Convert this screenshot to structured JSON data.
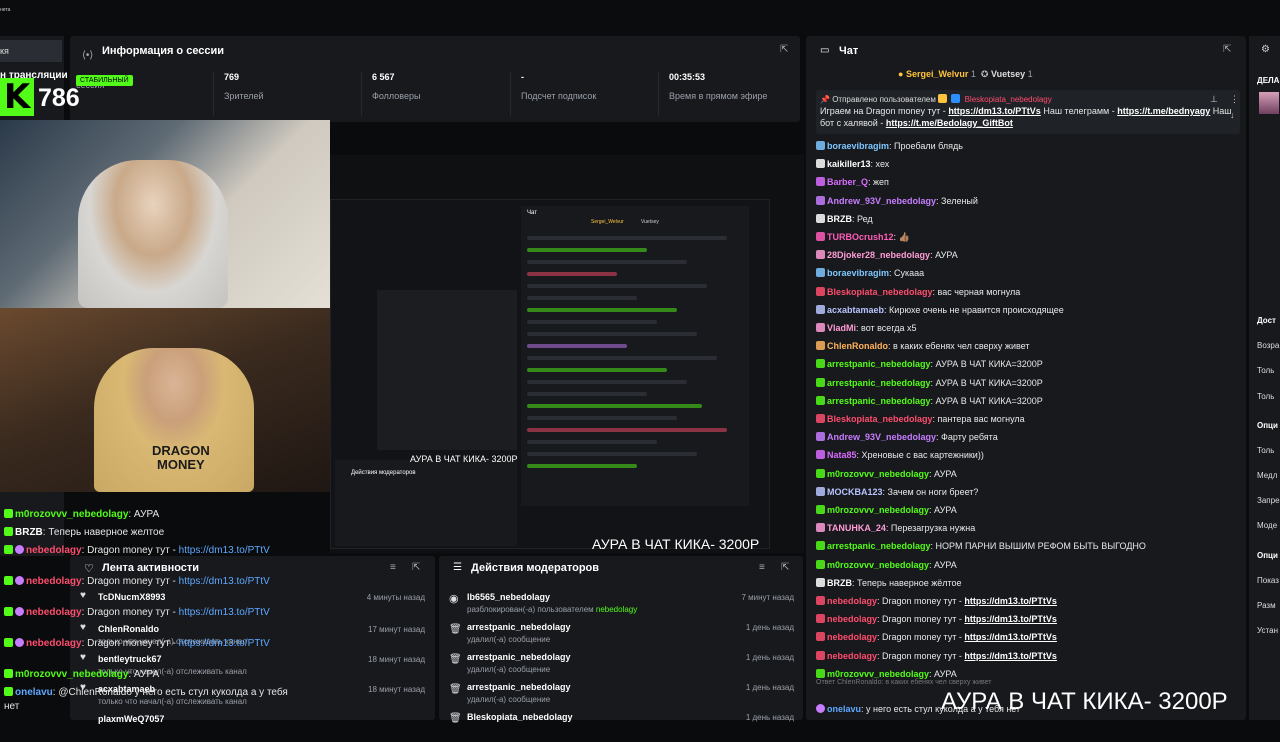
{
  "topbar": {
    "mini_label": "нета"
  },
  "left_strip": {
    "header": "кя",
    "stream_title": "н трансляции",
    "session_label": "сессия"
  },
  "session": {
    "title": "Информация о сессии",
    "stats": [
      {
        "value": "769",
        "label": "Зрителей"
      },
      {
        "value": "6 567",
        "label": "Фолловеры"
      },
      {
        "value": "-",
        "label": "Подсчет подписок"
      },
      {
        "value": "00:35:53",
        "label": "Время в прямом эфире"
      }
    ]
  },
  "kick_overlay": {
    "logo": "K",
    "viewers": "786",
    "badge": "СТАБИЛЬНЫЙ"
  },
  "cam": {
    "shirt_text": "DRAGON\nMONEY"
  },
  "nested": {
    "overlay1": "АУРА В ЧАТ КИКА- 3200Р",
    "overlay2": "АУРА В ЧАТ КИКА- 3200Р",
    "mod_title": "Действия модераторов",
    "chat_title": "Чат",
    "header_user1": "Sergei_Welvur",
    "header_user2": "Vuetsey"
  },
  "activity": {
    "title": "Лента активности",
    "items": [
      {
        "name": "TcDNucmX8993",
        "sub": "",
        "time": "4 минуты назад"
      },
      {
        "name": "ChlenRonaldo",
        "sub": "только что начал(-а) отслеживать канал",
        "time": "17 минут назад"
      },
      {
        "name": "bentleytruck67",
        "sub": "только что начал(-а) отслеживать канал",
        "time": "18 минут назад"
      },
      {
        "name": "acxabtamaeb",
        "sub": "только что начал(-а) отслеживать канал",
        "time": "18 минут назад"
      },
      {
        "name": "plaxmWeQ7057",
        "sub": "",
        "time": ""
      }
    ]
  },
  "modactions": {
    "title": "Действия модераторов",
    "items": [
      {
        "name": "lb6565_nebedolagy",
        "sub": "разблокирован(-а) пользователем ",
        "sub_user": "nebedolagy",
        "time": "7 минут назад",
        "icon": "unlock-icon"
      },
      {
        "name": "arrestpanic_nebedolagy",
        "sub": "удалил(-а) сообщение",
        "sub_user": "",
        "time": "1 день назад",
        "icon": "trash-icon"
      },
      {
        "name": "arrestpanic_nebedolagy",
        "sub": "удалил(-а) сообщение",
        "sub_user": "",
        "time": "1 день назад",
        "icon": "trash-icon"
      },
      {
        "name": "arrestpanic_nebedolagy",
        "sub": "удалил(-а) сообщение",
        "sub_user": "",
        "time": "1 день назад",
        "icon": "trash-icon"
      },
      {
        "name": "Bleskopiata_nebedolagy",
        "sub": "",
        "sub_user": "",
        "time": "1 день назад",
        "icon": "trash-icon"
      }
    ]
  },
  "overlay_chat": [
    {
      "user": "m0rozovvv_nebedolagy",
      "text": ": АУРА",
      "color": "#53fc18"
    },
    {
      "user": "BRZB",
      "text": ": Теперь наверное желтое",
      "color": "#ffffff"
    },
    {
      "user": "nebedolagy",
      "text": ": Dragon money тут - ",
      "link": "https://dm13.to/PTtV",
      "color": "#ff4d6d"
    },
    {
      "user": "nebedolagy",
      "text": ": Dragon money тут - ",
      "link": "https://dm13.to/PTtV",
      "color": "#ff4d6d"
    },
    {
      "user": "nebedolagy",
      "text": ": Dragon money тут - ",
      "link": "https://dm13.to/PTtV",
      "color": "#ff4d6d"
    },
    {
      "user": "nebedolagy",
      "text": ": Dragon money тут - ",
      "link": "https://dm13.to/PTtV",
      "color": "#ff4d6d"
    },
    {
      "user": "m0rozovvv_nebedolagy",
      "text": ": АУРА",
      "color": "#53fc18"
    },
    {
      "user": "onelavu",
      "text": ": @ChlenRonaldo у него есть стул куколда а у тебя",
      "color": "#5ea8ff"
    },
    {
      "user": "",
      "text": "нет",
      "color": "#ffffff"
    }
  ],
  "chat": {
    "title": "Чат",
    "header_user1": "Sergei_Welvur",
    "header_user2": "Vuetsey",
    "header_user1_count": "1",
    "header_user2_count": "1",
    "pinned_label": "Отправлено пользователем",
    "pinned_user": "Bleskopiata_nebedolagy",
    "pinned_text1": "Играем на Dragon money тут - ",
    "pinned_link1": "https://dm13.to/PTtVs",
    "pinned_text2": " Наш телеграмм - ",
    "pinned_link2": "https://t.me/bednyagy",
    "pinned_text3": " Наш",
    "pinned_line2_text": "бот с халявой - ",
    "pinned_link3": "https://t.me/Bedolagy_GiftBot",
    "messages": [
      {
        "user": "boraevibragim",
        "text": ": Проебали блядь",
        "color": "#7ec8ff"
      },
      {
        "user": "kaikiller13",
        "text": ": хех",
        "color": "#ffffff"
      },
      {
        "user": "Barber_Q",
        "text": ": жеп",
        "color": "#d96bff"
      },
      {
        "user": "Andrew_93V_nebedolagy",
        "text": ": Зеленый",
        "color": "#c77dff"
      },
      {
        "user": "BRZB",
        "text": ": Ред",
        "color": "#ffffff"
      },
      {
        "user": "TURBOcrush12",
        "text": ": 👍🏽",
        "color": "#ff5cb8"
      },
      {
        "user": "28Djoker28_nebedolagy",
        "text": ": АУРА",
        "color": "#ff9cd6"
      },
      {
        "user": "boraevibragim",
        "text": ": Сукааа",
        "color": "#7ec8ff"
      },
      {
        "user": "Bleskopiata_nebedolagy",
        "text": ": вас черная могнула",
        "color": "#ff4d6d"
      },
      {
        "user": "acxabtamaeb",
        "text": ": Кирюхе очень не нравится происходящее",
        "color": "#b8c4ff"
      },
      {
        "user": "VladMi",
        "text": ": вот всегда x5",
        "color": "#ff9cd6"
      },
      {
        "user": "ChlenRonaldo",
        "text": ": в каких ебенях чел сверху живет",
        "color": "#ffb35c"
      },
      {
        "user": "arrestpanic_nebedolagy",
        "text": ": АУРА В ЧАТ КИКА=3200Р",
        "color": "#53fc18"
      },
      {
        "user": "arrestpanic_nebedolagy",
        "text": ": АУРА В ЧАТ КИКА=3200Р",
        "color": "#53fc18"
      },
      {
        "user": "arrestpanic_nebedolagy",
        "text": ": АУРА В ЧАТ КИКА=3200Р",
        "color": "#53fc18"
      },
      {
        "user": "Bleskopiata_nebedolagy",
        "text": ": пантера вас могнула",
        "color": "#ff4d6d"
      },
      {
        "user": "Andrew_93V_nebedolagy",
        "text": ": Фарту ребята",
        "color": "#c77dff"
      },
      {
        "user": "Nata85",
        "text": ": Хреновые с вас картежники))",
        "color": "#d96bff"
      },
      {
        "user": "m0rozovvv_nebedolagy",
        "text": ": АУРА",
        "color": "#53fc18"
      },
      {
        "user": "MOCKBA123",
        "text": ": Зачем он ноги бреет?",
        "color": "#b8c4ff"
      },
      {
        "user": "m0rozovvv_nebedolagy",
        "text": ": АУРА",
        "color": "#53fc18"
      },
      {
        "user": "TANUHKA_24",
        "text": ": Перезагрузка нужна",
        "color": "#ff9cd6"
      },
      {
        "user": "arrestpanic_nebedolagy",
        "text": ": НОРМ ПАРНИ ВЫШИМ РЕФОМ БЫТЬ ВЫГОДНО",
        "color": "#53fc18"
      },
      {
        "user": "m0rozovvv_nebedolagy",
        "text": ": АУРА",
        "color": "#53fc18"
      },
      {
        "user": "BRZB",
        "text": ": Теперь наверное жёлтое",
        "color": "#ffffff"
      },
      {
        "user": "nebedolagy",
        "text": ": Dragon money тут - ",
        "link": "https://dm13.to/PTtVs",
        "color": "#ff4d6d"
      },
      {
        "user": "nebedolagy",
        "text": ": Dragon money тут - ",
        "link": "https://dm13.to/PTtVs",
        "color": "#ff4d6d"
      },
      {
        "user": "nebedolagy",
        "text": ": Dragon money тут - ",
        "link": "https://dm13.to/PTtVs",
        "color": "#ff4d6d"
      },
      {
        "user": "nebedolagy",
        "text": ": Dragon money тут - ",
        "link": "https://dm13.to/PTtVs",
        "color": "#ff4d6d"
      },
      {
        "user": "m0rozovvv_nebedolagy",
        "text": ": АУРА",
        "color": "#53fc18"
      }
    ],
    "reply_hint": "Ответ ChlenRonaldo: в каких ебенях чел сверху живет",
    "last_user": "onelavu",
    "last_text": ": у него есть стул куколда а у тебя нет"
  },
  "big_overlay": "АУРА В ЧАТ КИКА- 3200Р",
  "right_strip": {
    "items": [
      "ДЕЛА",
      "Дост",
      "Возра",
      "Толь",
      "Толь",
      "Опци",
      "Толь",
      "Медл",
      "Запре",
      "Моде",
      "Опци",
      "Показ",
      "Разм",
      "Устан"
    ]
  }
}
